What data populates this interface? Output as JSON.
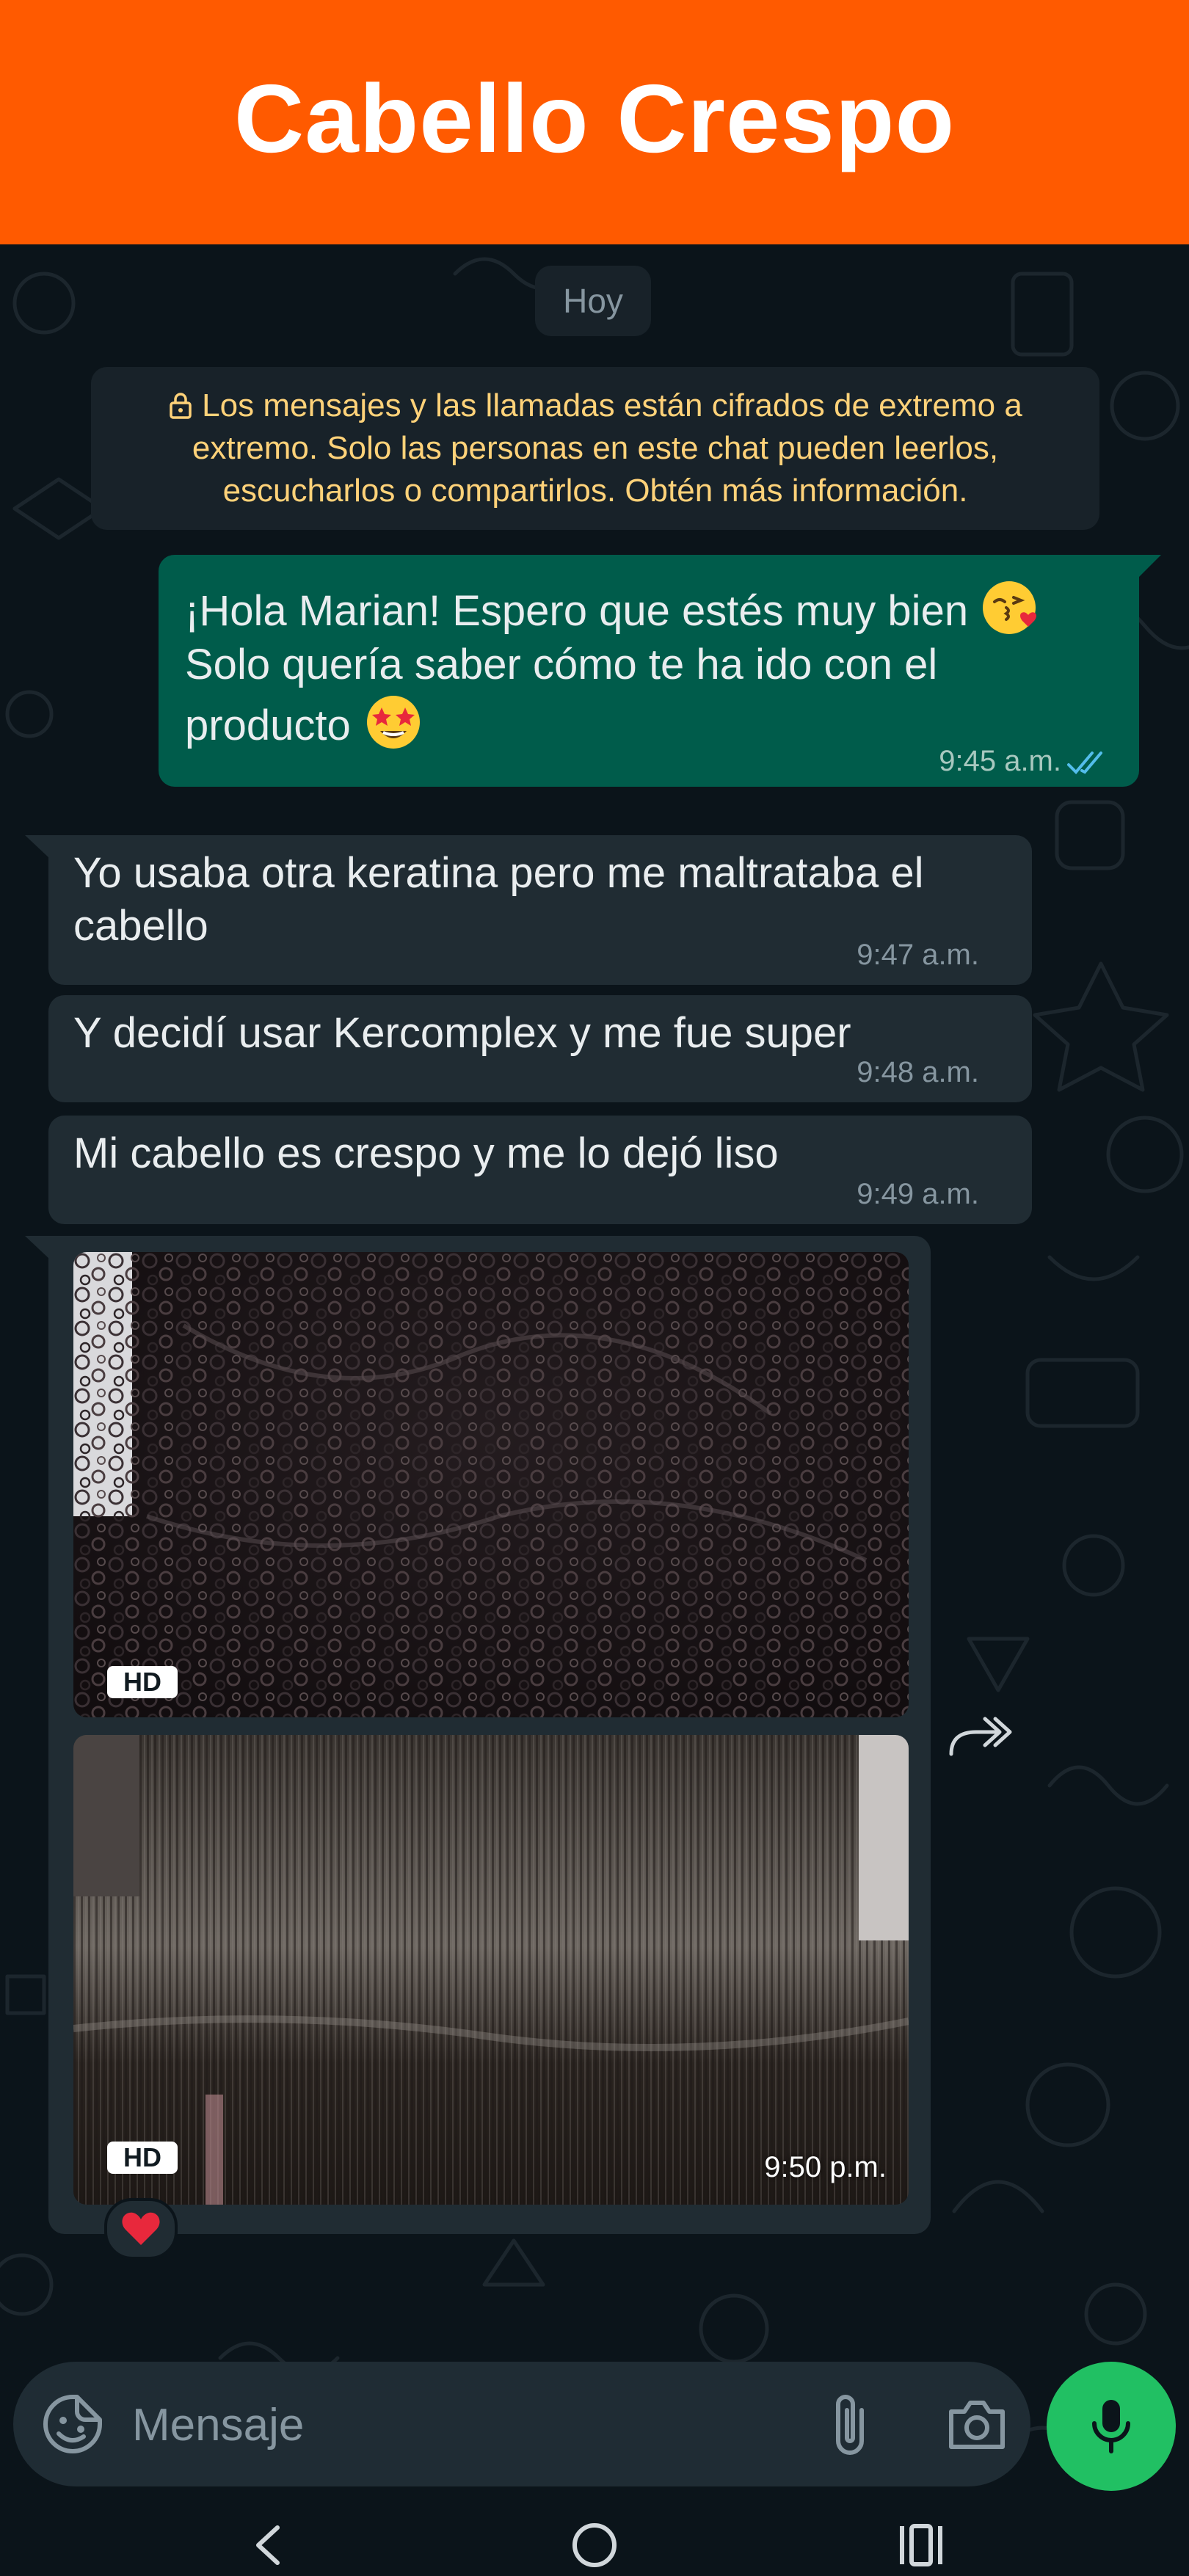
{
  "header": {
    "title": "Cabello Crespo"
  },
  "chat": {
    "date_chip": "Hoy",
    "encryption_notice": "Los mensajes y las llamadas están cifrados de extremo a extremo. Solo las personas en este chat pueden leerlos, escucharlos o compartirlos. Obtén más información.",
    "outgoing": {
      "text_part1": "¡Hola Marian! Espero que estés muy bien",
      "emoji1": "kissing-heart-emoji",
      "text_part2": "Solo quería saber cómo te ha ido con el producto",
      "emoji2": "star-struck-emoji",
      "time": "9:45 a.m.",
      "status": "read"
    },
    "incoming": [
      {
        "text": "Yo usaba otra keratina pero me maltrataba el cabello",
        "time": "9:47 a.m."
      },
      {
        "text": "Y decidí usar Kercomplex y me fue super",
        "time": "9:48 a.m."
      },
      {
        "text": "Mi cabello es crespo y me lo dejó liso",
        "time": "9:49 a.m."
      }
    ],
    "photos": {
      "hd_label": "HD",
      "time": "9:50 p.m.",
      "reaction": "heart"
    }
  },
  "composer": {
    "placeholder": "Mensaje"
  },
  "colors": {
    "header": "#ff5a00",
    "chat_bg": "#0b141a",
    "outgoing_bubble": "#005c4b",
    "incoming_bubble": "#202c33",
    "notice_text": "#ffd279",
    "mic_button": "#21c063",
    "read_ticks": "#53bdeb"
  }
}
